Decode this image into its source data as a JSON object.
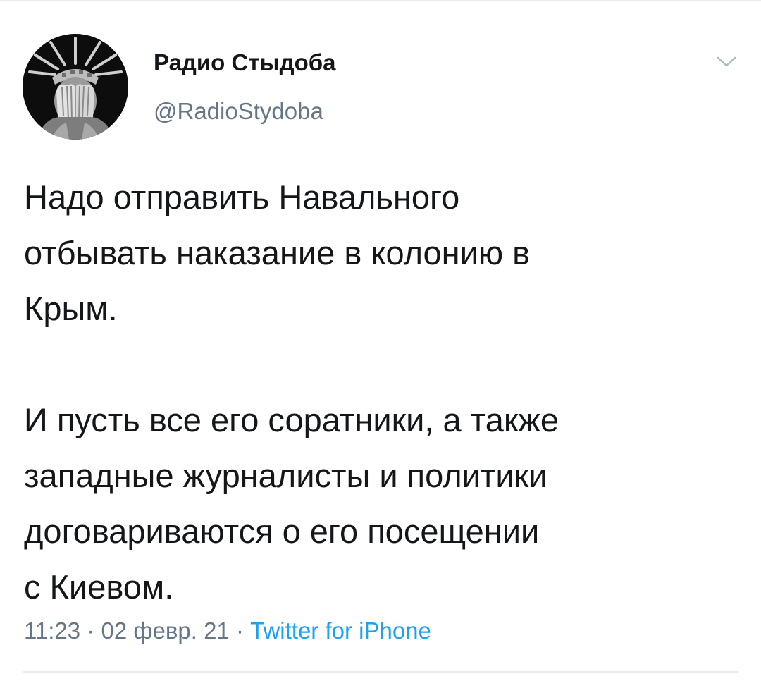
{
  "author": {
    "display_name": "Радио Стыдоба",
    "handle": "@RadioStydoba",
    "avatar_icon": "statue-of-liberty-facepalm-avatar"
  },
  "tweet": {
    "paragraph1": [
      "Надо отправить Навального",
      "отбывать наказание в колонию в",
      "Крым."
    ],
    "paragraph2": [
      "И пусть все его соратники, а также",
      "западные журналисты и политики",
      "договариваются о его посещении",
      "с Киевом."
    ]
  },
  "meta": {
    "time": "11:23",
    "date": "02 февр. 21",
    "separator": " · ",
    "source": "Twitter for iPhone"
  },
  "icons": {
    "caret": "chevron-down-icon"
  },
  "colors": {
    "text": "#14171a",
    "secondary": "#657786",
    "link": "#1da1f2",
    "divider": "#e6ecf0"
  }
}
